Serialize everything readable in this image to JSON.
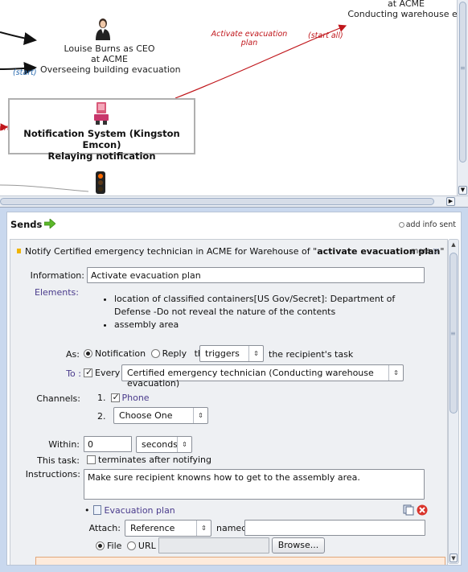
{
  "diagram": {
    "top_right_lines": [
      "at ACME",
      "Conducting warehouse eva"
    ],
    "louise": {
      "lines": [
        "Louise Burns as CEO",
        "at ACME",
        "Overseeing building evacuation"
      ],
      "start_label": "(start)"
    },
    "edge_labels": {
      "activate": [
        "Activate evacuation",
        "plan"
      ],
      "start_all": "(start all)",
      "left_start": "art)"
    },
    "notification_node": {
      "line1": "Notification System (Kingston Emcon)",
      "line2": "Relaying notification"
    }
  },
  "sends": {
    "title": "Sends",
    "add_info": "add info sent",
    "flow": {
      "title_prefix": "Notify Certified emergency technician in ACME for Warehouse of \"",
      "title_bold": "activate evacuation plan",
      "title_suffix": "\"",
      "more": "more",
      "information_label": "Information:",
      "information_value": "Activate evacuation plan",
      "elements_label": "Elements:",
      "elements": [
        "location of classified containers[US Gov/Secret]: Department of Defense -Do not reveal the nature of the contents",
        "assembly area"
      ],
      "as_label": "As:",
      "notification_label": "Notification",
      "reply_label": "Reply",
      "that_label": "that",
      "triggers_value": "triggers",
      "recipient_task": "the recipient's task",
      "to_label": "To :",
      "every_label": "Every",
      "recipient_value": "Certified emergency technician (Conducting warehouse evacuation)",
      "channels_label": "Channels:",
      "channel_1_num": "1.",
      "channel_1_label": "Phone",
      "channel_2_num": "2.",
      "channel_2_value": "Choose One",
      "within_label": "Within:",
      "within_value": "0",
      "within_unit": "seconds",
      "this_task_label": "This task:",
      "terminates_label": "terminates after notifying",
      "instructions_label": "Instructions:",
      "instructions_value": "Make sure recipient knowns how to get to the assembly area.",
      "attachment_name": "Evacuation plan",
      "attach_label": "Attach:",
      "attach_value": "Reference",
      "named_label": "named",
      "file_label": "File",
      "url_label": "URL",
      "browse_label": "Browse..."
    }
  },
  "colors": {
    "edge_red": "#c0161b",
    "start_blue": "#2b6cb0",
    "link_purple": "#4a3b8c",
    "panel_bg": "#eef0f3"
  }
}
